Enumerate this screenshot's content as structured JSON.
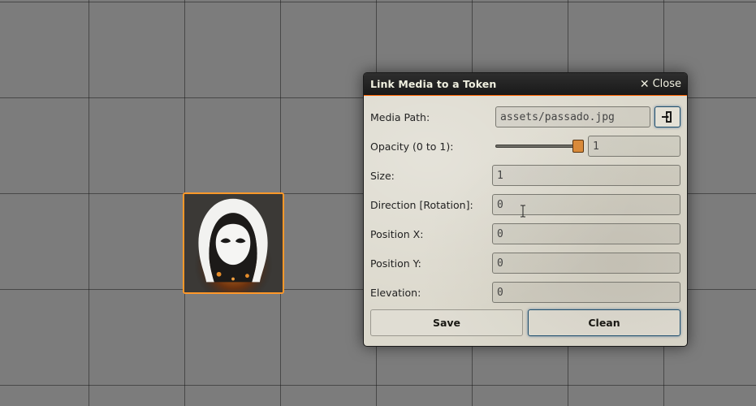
{
  "dialog": {
    "title": "Link Media to a Token",
    "close_label": "Close",
    "close_icon": "close-icon",
    "fields": {
      "media_path": {
        "label": "Media Path:",
        "value": "assets/passado.jpg"
      },
      "opacity": {
        "label": "Opacity (0 to 1):",
        "value": "1",
        "slider_level": 1
      },
      "size": {
        "label": "Size:",
        "value": "1"
      },
      "direction": {
        "label": "Direction [Rotation]:",
        "value": "0"
      },
      "position_x": {
        "label": "Position X:",
        "value": "0"
      },
      "position_y": {
        "label": "Position Y:",
        "value": "0"
      },
      "elevation": {
        "label": "Elevation:",
        "value": "0"
      }
    },
    "save_label": "Save",
    "clean_label": "Clean"
  },
  "colors": {
    "canvas": "#7c7c7c",
    "header": "#1f1f1f",
    "accent": "#ff6400",
    "token_border": "#ff9829",
    "slider_thumb": "#d98a3a"
  },
  "icons": {
    "file_picker": "file-import-icon",
    "token": "hooded-figure-icon"
  }
}
